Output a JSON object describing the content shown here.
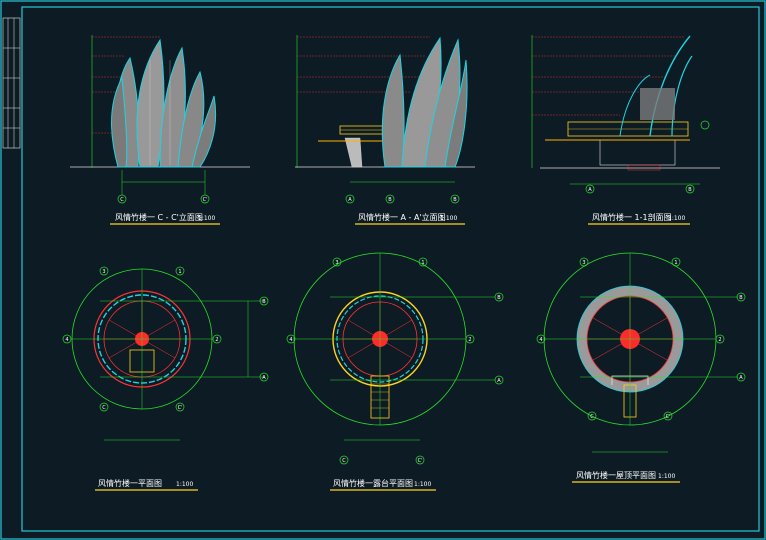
{
  "titles": {
    "elev_c": "风情竹楼一 C - C'立面图",
    "elev_a": "风情竹楼一 A - A'立面图",
    "section": "风情竹楼一 1-1剖面图",
    "plan": "风情竹楼一平面图",
    "platform": "风情竹楼一露台平面图",
    "roof": "风情竹楼一屋顶平面图"
  },
  "scales": {
    "s100": "1:100"
  },
  "axes": {
    "a": "A",
    "b": "B",
    "c": "C",
    "c2": "C'",
    "one": "1",
    "two": "2",
    "three": "3",
    "four": "4"
  },
  "colors": {
    "background": "#0d1b24",
    "frame": "#28c8d8",
    "bamboo": "#1fd3e0",
    "axis_green": "#29e02b",
    "red": "#ff2a2a",
    "yellow": "#ffd21e",
    "grey": "#9a9a9a"
  }
}
